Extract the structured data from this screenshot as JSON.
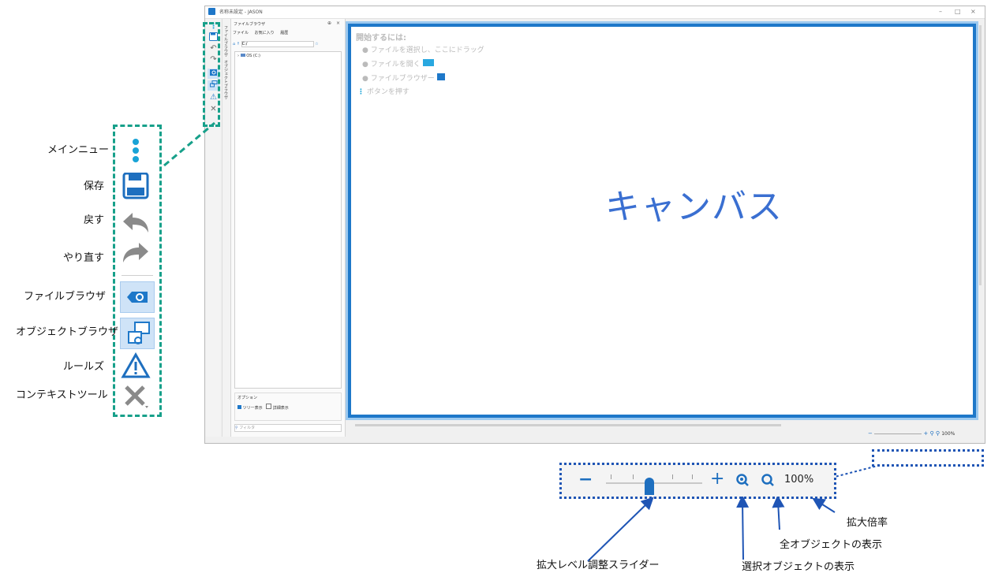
{
  "window": {
    "title": "名称未設定 - JASON",
    "minimize": "–",
    "maximize": "□",
    "close": "×"
  },
  "toolbar_icons": [
    "more-icon",
    "save-icon",
    "undo-icon",
    "redo-icon",
    "file-browser-icon",
    "object-browser-icon",
    "rules-icon",
    "context-tools-icon"
  ],
  "side_tabs": {
    "file_browser": "ファイルブラウザ",
    "object_browser": "オブジェクトブラウザ"
  },
  "file_browser": {
    "title": "ファイルブラウザ",
    "tabs": [
      "ファイル",
      "お気に入り",
      "履歴"
    ],
    "path": "C:/",
    "tree_item": "OS (C:)",
    "options_label": "オプション",
    "option_tree": "ツリー表示",
    "option_detail": "詳細表示",
    "filter_placeholder": "フィルタ"
  },
  "canvas": {
    "hint_title": "開始するには:",
    "hint_1": "ファイルを選択し、ここにドラッグ",
    "hint_2": "ファイルを開く",
    "hint_3": "ファイルブラウザー",
    "hint_4": "ボタンを押す",
    "label": "キャンバス"
  },
  "zoom": {
    "minus": "−",
    "plus": "+",
    "level": "100%",
    "slider_fraction": 0.45
  },
  "annotations": {
    "main_menu": "メインニュー",
    "save": "保存",
    "undo": "戻す",
    "redo": "やり直す",
    "file_browser": "ファイルブラウザ",
    "object_browser": "オブジェクトブラウザ",
    "rules": "ルールズ",
    "context_tools": "コンテキストツール",
    "zoom_slider": "拡大レベル調整スライダー",
    "zoom_selected": "選択オブジェクトの表示",
    "zoom_all": "全オブジェクトの表示",
    "zoom_ratio": "拡大倍率"
  },
  "colors": {
    "accent": "#1e78c9",
    "callout_green": "#17a08a",
    "callout_blue": "#1f55b5",
    "canvas_text": "#3a6fd1"
  }
}
